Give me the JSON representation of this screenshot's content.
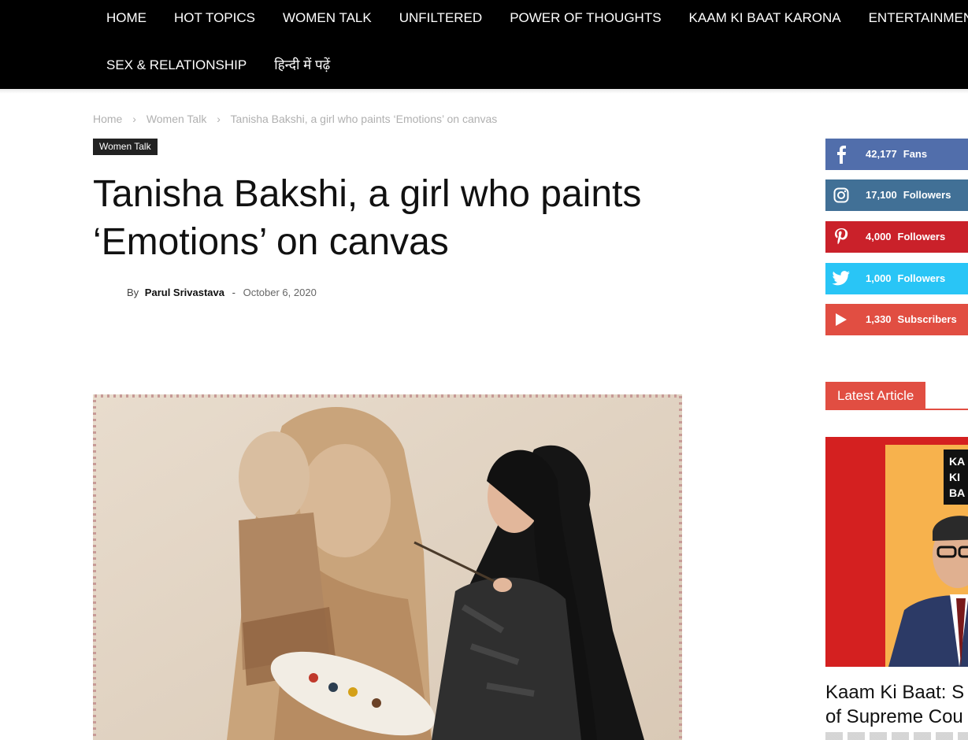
{
  "nav": {
    "row1": [
      "HOME",
      "HOT TOPICS",
      "WOMEN TALK",
      "UNFILTERED",
      "POWER OF THOUGHTS",
      "KAAM KI BAAT KARONA",
      "ENTERTAINMENT"
    ],
    "row2": [
      "SEX & RELATIONSHIP",
      "हिन्दी में पढ़ें"
    ]
  },
  "breadcrumb": {
    "home": "Home",
    "category": "Women Talk",
    "current": "Tanisha Bakshi, a girl who paints ‘Emotions’ on canvas",
    "separator": "›"
  },
  "article": {
    "category_badge": "Women Talk",
    "title_line1": "Tanisha Bakshi, a girl who paints",
    "title_line2": "‘Emotions’ on canvas",
    "by_label": "By",
    "author": "Parul Srivastava",
    "date_separator": "-",
    "date": "October 6, 2020"
  },
  "social": {
    "facebook": {
      "count": "42,177",
      "label": "Fans",
      "icon": "facebook-icon",
      "color": "#516eab"
    },
    "instagram": {
      "count": "17,100",
      "label": "Followers",
      "icon": "instagram-icon",
      "color": "#417096"
    },
    "pinterest": {
      "count": "4,000",
      "label": "Followers",
      "icon": "pinterest-icon",
      "color": "#ca212a"
    },
    "twitter": {
      "count": "1,000",
      "label": "Followers",
      "icon": "twitter-icon",
      "color": "#29c5f6"
    },
    "youtube": {
      "count": "1,330",
      "label": "Subscribers",
      "icon": "play-icon",
      "color": "#e14e42"
    }
  },
  "sidebar": {
    "block_title": "Latest Article",
    "thumb_text": [
      "KA",
      "KI",
      "BA"
    ],
    "latest_title_line1": "Kaam Ki Baat: S",
    "latest_title_line2": "of Supreme Cou"
  },
  "colors": {
    "nav_bg": "#000000",
    "accent": "#e14e42"
  }
}
